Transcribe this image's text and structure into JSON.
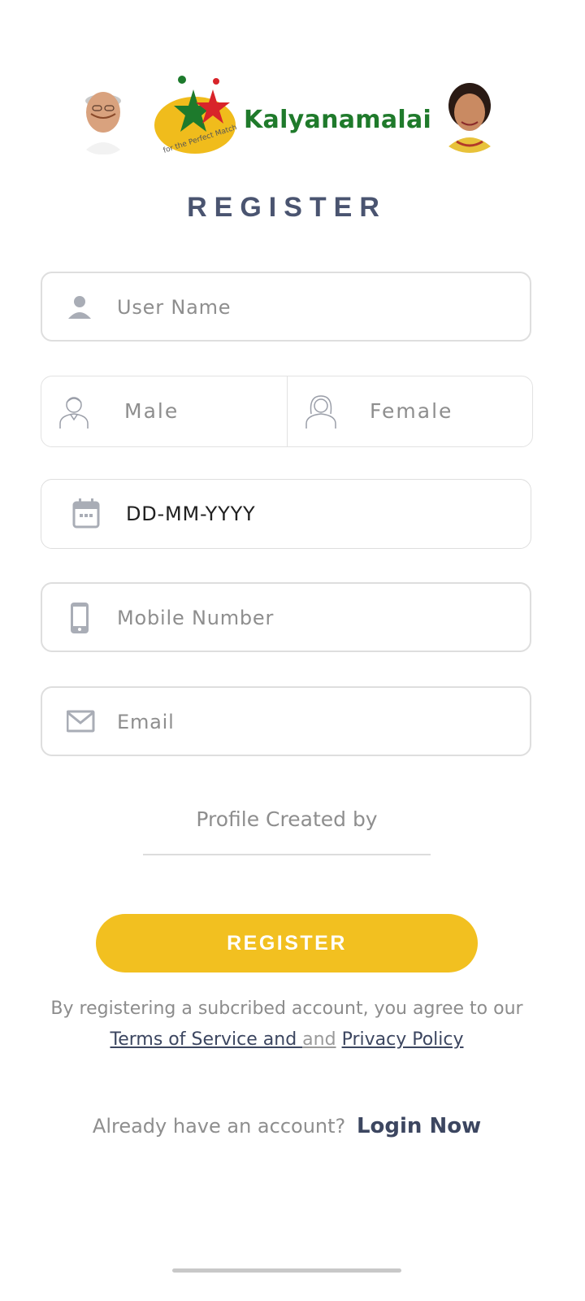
{
  "header": {
    "brand_name": "Kalyanamalai",
    "tagline": "for the Perfect Match",
    "title": "REGISTER"
  },
  "form": {
    "username": {
      "placeholder": "User Name",
      "icon": "person-icon"
    },
    "gender": {
      "male_label": "Male",
      "female_label": "Female"
    },
    "dob": {
      "value": "DD-MM-YYYY",
      "icon": "calendar-icon"
    },
    "mobile": {
      "placeholder": "Mobile Number",
      "icon": "phone-icon"
    },
    "email": {
      "placeholder": "Email",
      "icon": "mail-icon"
    },
    "profile_created_by": {
      "placeholder": "Profile Created by"
    }
  },
  "actions": {
    "register_label": "REGISTER"
  },
  "legal": {
    "text": "By registering a subcribed account, you agree to our",
    "terms_label": "Terms of Service and ",
    "and_label": "and",
    "privacy_label": "Privacy Policy"
  },
  "login": {
    "prompt": "Already have an account?",
    "link_label": "Login Now"
  },
  "colors": {
    "accent": "#f2c020",
    "title": "#4a5470",
    "brand_green": "#1f7a2b",
    "placeholder": "#8e8e8e",
    "border": "#dedede"
  }
}
